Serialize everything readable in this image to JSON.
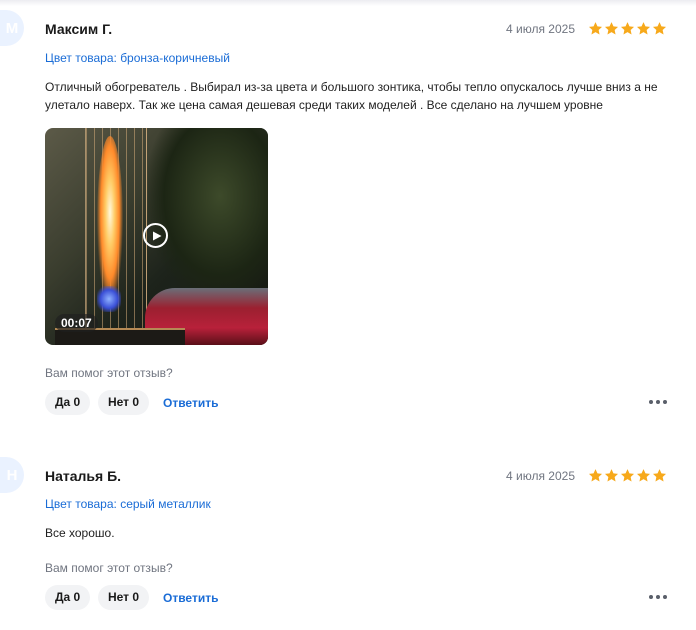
{
  "reviews": [
    {
      "avatar_letter": "М",
      "author": "Максим Г.",
      "date": "4 июля 2025",
      "rating": 5,
      "variant": "Цвет товара: бронза-коричневый",
      "text": "Отличный обогреватель . Выбирал из-за цвета и большого зонтика, чтобы тепло опускалось лучше вниз а не улетало наверх. Так же цена самая дешевая среди таких моделей . Все сделано на лучшем уровне",
      "video": {
        "duration": "00:07",
        "icon": "play-icon"
      },
      "helpful_question": "Вам помог этот отзыв?",
      "yes_label": "Да 0",
      "no_label": "Нет 0",
      "reply_label": "Ответить",
      "more_icon": "more-dots-icon"
    },
    {
      "avatar_letter": "Н",
      "author": "Наталья Б.",
      "date": "4 июля 2025",
      "rating": 5,
      "variant": "Цвет товара: серый металлик",
      "text": "Все хорошо.",
      "helpful_question": "Вам помог этот отзыв?",
      "yes_label": "Да 0",
      "no_label": "Нет 0",
      "reply_label": "Ответить",
      "more_icon": "more-dots-icon"
    }
  ],
  "colors": {
    "star": "#f7a91b",
    "link": "#1a6cd6",
    "muted": "#707580",
    "pill_bg": "#f2f3f5",
    "avatar_bg": "#eaf2ff"
  }
}
